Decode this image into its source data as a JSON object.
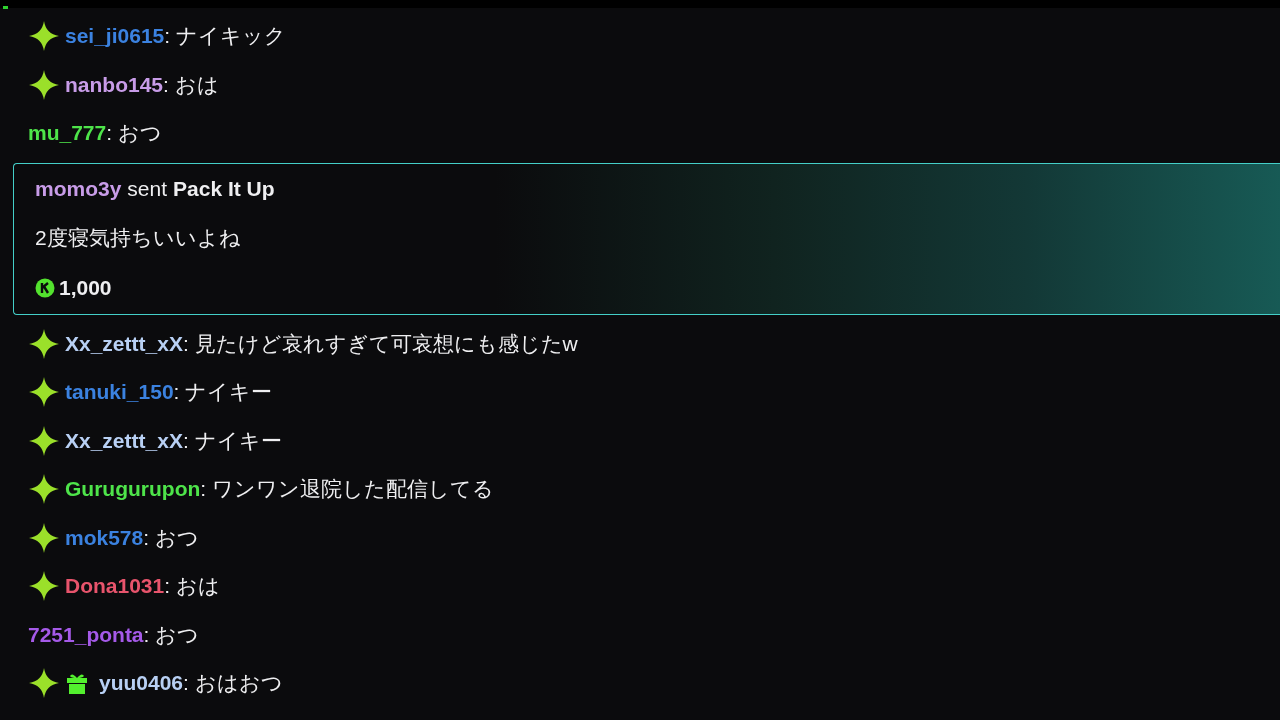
{
  "messages": [
    {
      "kind": "chat",
      "sparkle": true,
      "gift": false,
      "user": "sei_ji0615",
      "color": "#3b82e0",
      "text": ": ナイキック"
    },
    {
      "kind": "chat",
      "sparkle": true,
      "gift": false,
      "user": "nanbo145",
      "color": "#c89ce8",
      "text": ": おは"
    },
    {
      "kind": "chat",
      "sparkle": false,
      "gift": false,
      "user": "mu_777",
      "color": "#4ee44a",
      "text": ": おつ"
    },
    {
      "kind": "gift_card",
      "user": "momo3y",
      "color": "#c89ce8",
      "verb": "sent",
      "item": "Pack It Up",
      "text": "2度寝気持ちいいよね",
      "amount": "1,000"
    },
    {
      "kind": "chat",
      "sparkle": true,
      "gift": false,
      "user": "Xx_zettt_xX",
      "color": "#b8d0f4",
      "text": ": 見たけど哀れすぎて可哀想にも感じたw"
    },
    {
      "kind": "chat",
      "sparkle": true,
      "gift": false,
      "user": "tanuki_150",
      "color": "#3b82e0",
      "text": ": ナイキー"
    },
    {
      "kind": "chat",
      "sparkle": true,
      "gift": false,
      "user": "Xx_zettt_xX",
      "color": "#b8d0f4",
      "text": ": ナイキー"
    },
    {
      "kind": "chat",
      "sparkle": true,
      "gift": false,
      "user": "Gurugurupon",
      "color": "#4ee44a",
      "text": ": ワンワン退院した配信してる"
    },
    {
      "kind": "chat",
      "sparkle": true,
      "gift": false,
      "user": "mok578",
      "color": "#3b82e0",
      "text": ": おつ"
    },
    {
      "kind": "chat",
      "sparkle": true,
      "gift": false,
      "user": "Dona1031",
      "color": "#e8546c",
      "text": ": おは"
    },
    {
      "kind": "chat",
      "sparkle": false,
      "gift": false,
      "user": "7251_ponta",
      "color": "#a55ae8",
      "text": ": おつ"
    },
    {
      "kind": "chat",
      "sparkle": true,
      "gift": true,
      "user": "yuu0406",
      "color": "#b8d0f4",
      "text": ": おはおつ"
    }
  ]
}
